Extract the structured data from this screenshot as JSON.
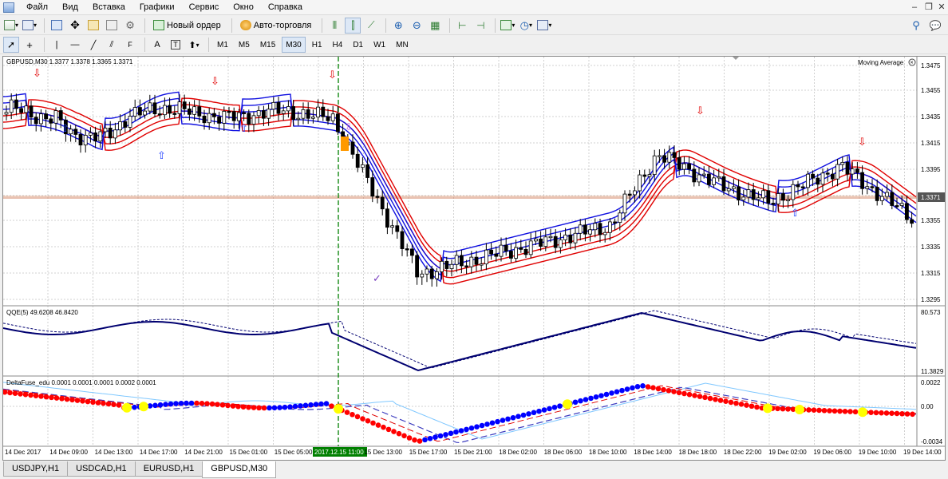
{
  "menu": {
    "items": [
      "Файл",
      "Вид",
      "Вставка",
      "Графики",
      "Сервис",
      "Окно",
      "Справка"
    ]
  },
  "toolbar": {
    "new_order_label": "Новый ордер",
    "auto_trading_label": "Авто-торговля"
  },
  "timeframes": [
    "M1",
    "M5",
    "M15",
    "M30",
    "H1",
    "H4",
    "D1",
    "W1",
    "MN"
  ],
  "active_timeframe": "M30",
  "chart": {
    "symbol_info": "GBPUSD,M30  1.3377 1.3378 1.3365 1.3371",
    "indicator_name": "Moving Average",
    "price_labels": [
      "1.3475",
      "1.3455",
      "1.3435",
      "1.3415",
      "1.3395",
      "1.3375",
      "1.3355",
      "1.3335",
      "1.3315",
      "1.3295"
    ],
    "current_price": "1.3371",
    "time_labels": [
      "14 Dec 2017",
      "14 Dec 09:00",
      "14 Dec 13:00",
      "14 Dec 17:00",
      "14 Dec 21:00",
      "15 Dec 01:00",
      "15 Dec 05:00",
      "2017.12.15 11:00",
      "15 Dec 13:00",
      "15 Dec 17:00",
      "15 Dec 21:00",
      "18 Dec 02:00",
      "18 Dec 06:00",
      "18 Dec 10:00",
      "18 Dec 14:00",
      "18 Dec 18:00",
      "18 Dec 22:00",
      "19 Dec 02:00",
      "19 Dec 06:00",
      "19 Dec 10:00",
      "19 Dec 14:00"
    ],
    "highlighted_time": "2017.12.15 11:00"
  },
  "qqe_panel": {
    "label": "QQE(5) 49.6208 46.8420",
    "max_label": "80.573",
    "min_label": "11.3829"
  },
  "fuse_panel": {
    "label": "DeltaFuse_edu 0.0001 0.0001 0.0001 0.0002 0.0001",
    "max_label": "0.0022",
    "zero_label": "0.00",
    "min_label": "-0.0034"
  },
  "tabs": [
    "USDJPY,H1",
    "USDCAD,H1",
    "EURUSD,H1",
    "GBPUSD,M30"
  ],
  "active_tab": "GBPUSD,M30",
  "colors": {
    "bull_candle": "#ffffff",
    "bear_candle": "#000000",
    "ma_red": "#e00000",
    "ma_blue": "#1010e0",
    "qqe_line": "#000070",
    "dot_red": "#ff0000",
    "dot_blue": "#0000ff",
    "dot_yellow": "#ffff00",
    "vline": "#008000",
    "price_line": "#d08060"
  }
}
